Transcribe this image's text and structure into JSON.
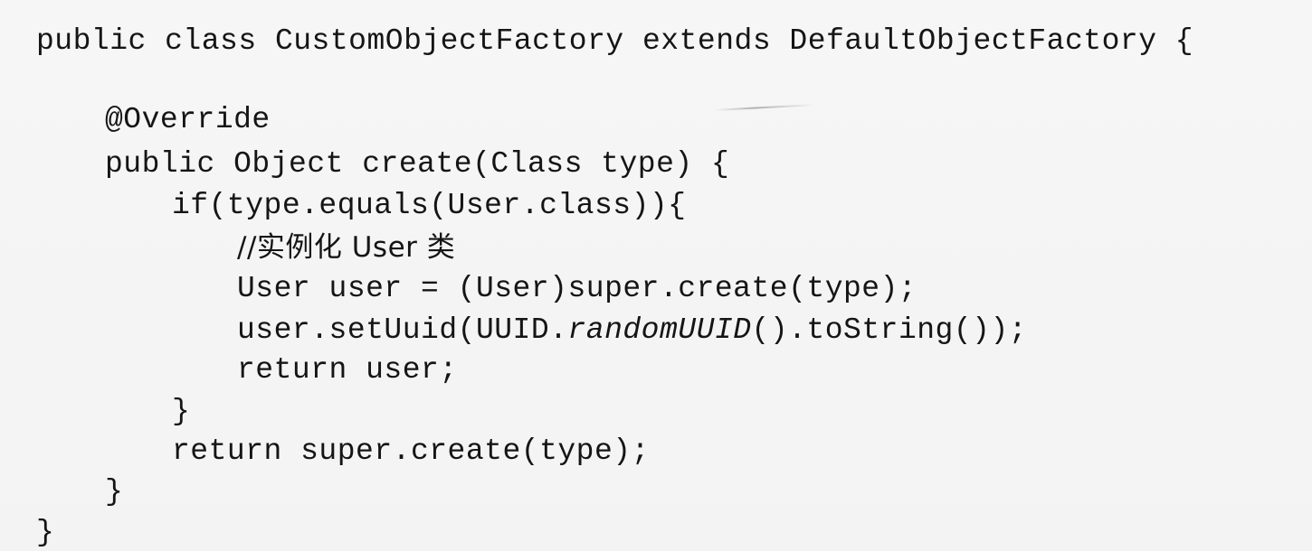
{
  "code": {
    "lines": [
      "public class CustomObjectFactory extends DefaultObjectFactory {",
      "@Override",
      "public Object create(Class type) {",
      "if(type.equals(User.class)){",
      "//实例化 User 类",
      "User user = (User)super.create(type);",
      "user.setUuid(UUID.",
      "randomUUID",
      "().toString());",
      "return user;",
      "}",
      "return super.create(type);",
      "}",
      "}"
    ]
  }
}
